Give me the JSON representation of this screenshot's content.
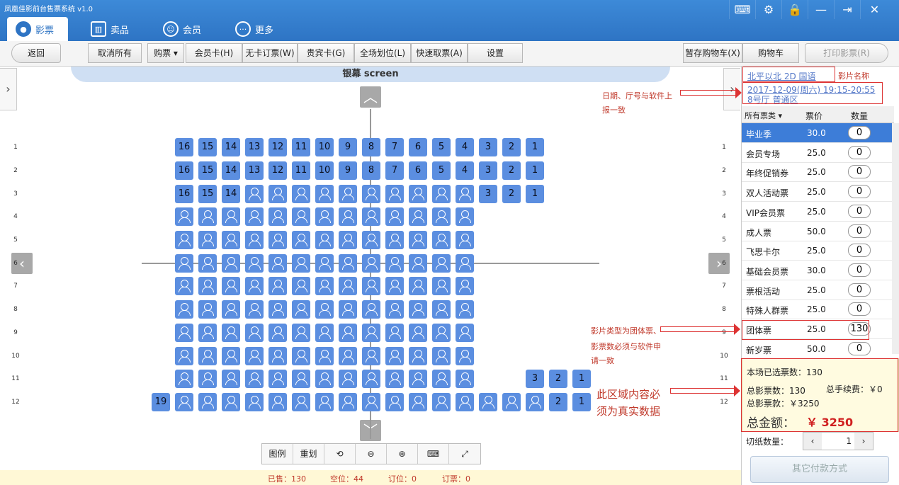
{
  "app": {
    "title": "凤凰佳影前台售票系统 v1.0"
  },
  "window_buttons": [
    "keyboard-icon",
    "gear-icon",
    "lock-icon",
    "minimize-icon",
    "logout-icon",
    "close-icon"
  ],
  "tabs": [
    {
      "label": "影票",
      "icon": "film-reel-icon",
      "active": true
    },
    {
      "label": "卖品",
      "icon": "popcorn-icon",
      "active": false
    },
    {
      "label": "会员",
      "icon": "user-icon",
      "active": false
    },
    {
      "label": "更多",
      "icon": "more-icon",
      "active": false
    }
  ],
  "toolbar": {
    "back": "返回",
    "cancel_all": "取消所有",
    "buy": "购票",
    "member_card": "会员卡(H)",
    "no_card_book": "无卡订票(W)",
    "vip_card": "贵宾卡(G)",
    "full_hall": "全场划位(L)",
    "quick_take": "快速取票(A)",
    "settings": "设置",
    "hold_cart": "暂存购物车(X)",
    "cart": "购物车",
    "print": "打印影票(R)"
  },
  "screen": {
    "label": "银幕 screen"
  },
  "seating": {
    "rows": [
      "1",
      "2",
      "3",
      "4",
      "5",
      "6",
      "7",
      "8",
      "9",
      "10",
      "11",
      "12"
    ]
  },
  "legend_bar": {
    "legend": "图例",
    "redraw": "重划",
    "rotate_icon": "rotate-icon",
    "zoom_out_icon": "zoom-out-icon",
    "zoom_in_icon": "zoom-in-icon",
    "keyboard_icon": "keyboard-icon",
    "fullscreen_icon": "fullscreen-icon"
  },
  "status": {
    "sold": "已售：130",
    "empty": "空位：44",
    "booked": "订位：0",
    "reserved": "订票：0"
  },
  "movie": {
    "title": "北平以北  2D  国语",
    "time": "2017-12-09(周六)  19:15-20:55",
    "hall": "8号厅  普通区"
  },
  "ticket_table": {
    "headers": [
      "所有票类",
      "票价",
      "数量"
    ],
    "rows": [
      {
        "name": "毕业季",
        "price": "30.0",
        "qty": "0",
        "selected": true
      },
      {
        "name": "会员专场",
        "price": "25.0",
        "qty": "0"
      },
      {
        "name": "年终促销券",
        "price": "25.0",
        "qty": "0"
      },
      {
        "name": "双人活动票",
        "price": "25.0",
        "qty": "0"
      },
      {
        "name": "VIP会员票",
        "price": "25.0",
        "qty": "0"
      },
      {
        "name": "成人票",
        "price": "50.0",
        "qty": "0"
      },
      {
        "name": "飞思卡尔",
        "price": "25.0",
        "qty": "0"
      },
      {
        "name": "基础会员票",
        "price": "30.0",
        "qty": "0"
      },
      {
        "name": "票根活动",
        "price": "25.0",
        "qty": "0"
      },
      {
        "name": "特殊人群票",
        "price": "25.0",
        "qty": "0"
      },
      {
        "name": "团体票",
        "price": "25.0",
        "qty": "130"
      },
      {
        "name": "新岁票",
        "price": "50.0",
        "qty": "0"
      }
    ]
  },
  "summary": {
    "selected": "本场已选票数：130",
    "total_tickets": "总影票数：130",
    "fee": "总手续费：￥0",
    "ticket_amount": "总影票款：￥3250",
    "total_label": "总金额：",
    "total_value": "￥ 3250"
  },
  "paper": {
    "label": "切纸数量：",
    "value": "1"
  },
  "other_pay": "其它付款方式",
  "annotations": {
    "movie_name": "影片名称",
    "date_note_1": "日期、厅号与软件上",
    "date_note_2": "报一致",
    "type_note_1": "影片类型为团体票、",
    "type_note_2": "影票数必须与软件申",
    "type_note_3": "请一致",
    "area_note_1": "此区域内容必",
    "area_note_2": "须为真实数据"
  },
  "colors": {
    "accent": "#2e74c4",
    "seat": "#5b8ee0",
    "annotation": "#c0392b"
  }
}
